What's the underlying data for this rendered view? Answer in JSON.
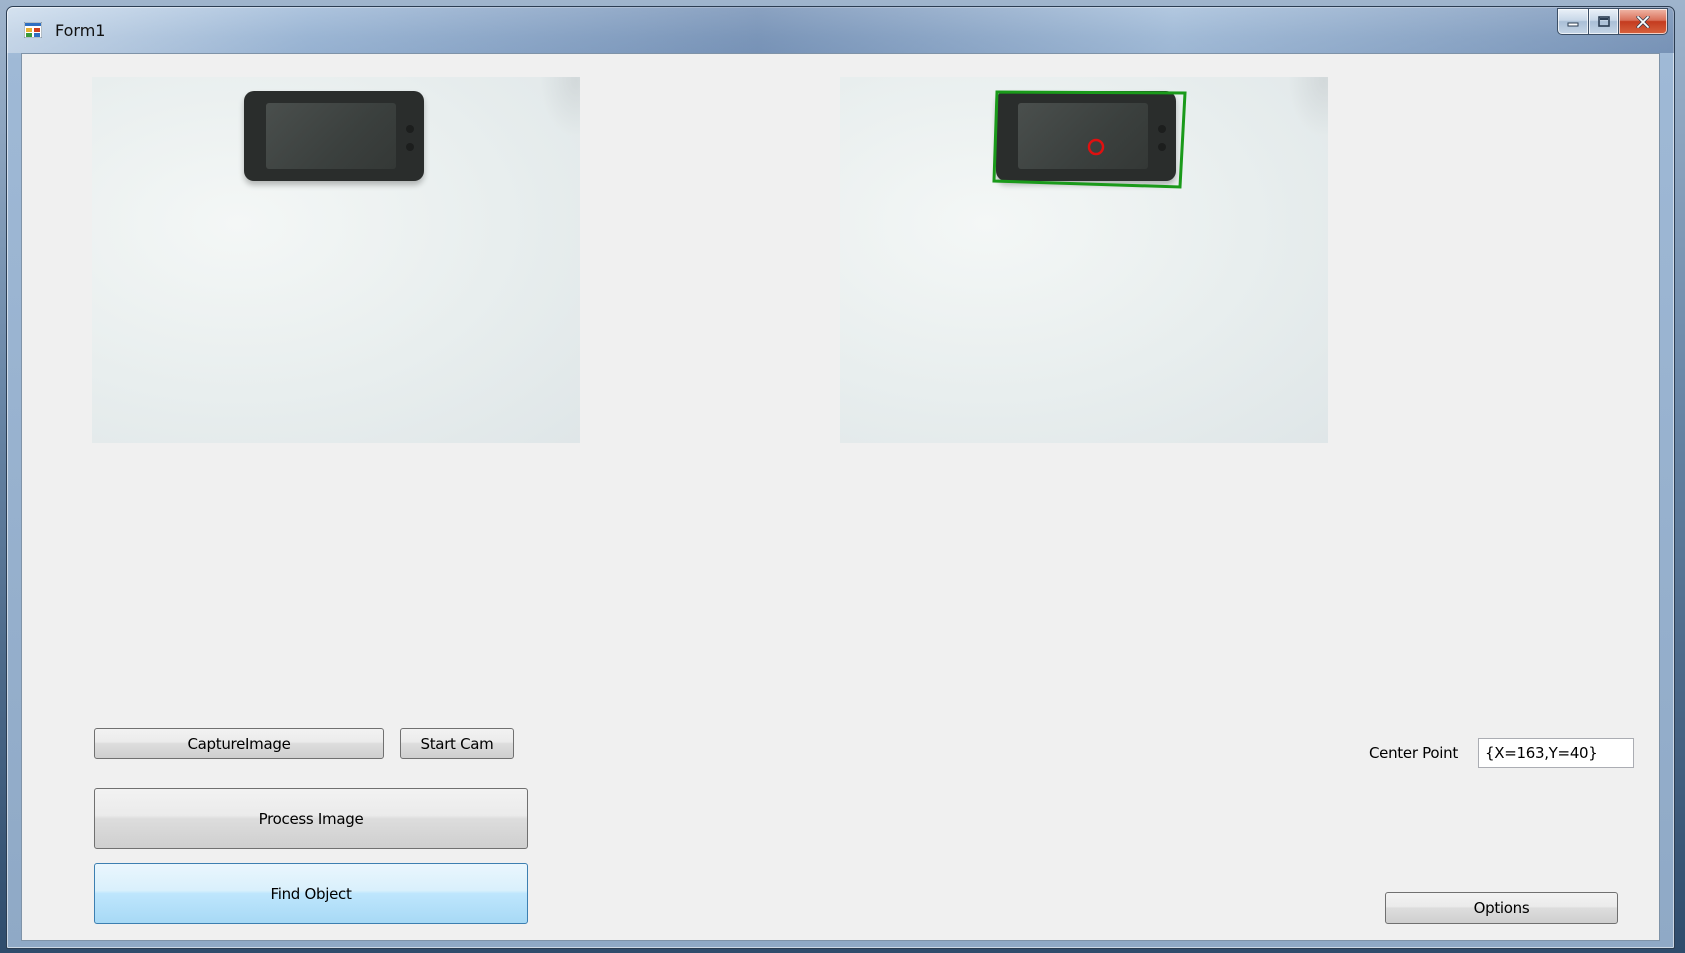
{
  "window": {
    "title": "Form1",
    "icons": {
      "app": "form-app-icon",
      "minimize": "minimize-icon",
      "maximize": "maximize-icon",
      "close": "close-icon"
    }
  },
  "images": {
    "left": {
      "content": "camera-capture-phone"
    },
    "right": {
      "content": "processed-phone-detected"
    }
  },
  "buttons": {
    "capture_image": "CaptureImage",
    "start_cam": "Start Cam",
    "process_image": "Process Image",
    "find_object": "Find Object",
    "options": "Options"
  },
  "center_point": {
    "label": "Center Point",
    "value": "{X=163,Y=40}"
  },
  "colors": {
    "detection_outline": "#1a9a1a",
    "center_marker": "#e01010",
    "focused_button": "#bee6fd"
  }
}
